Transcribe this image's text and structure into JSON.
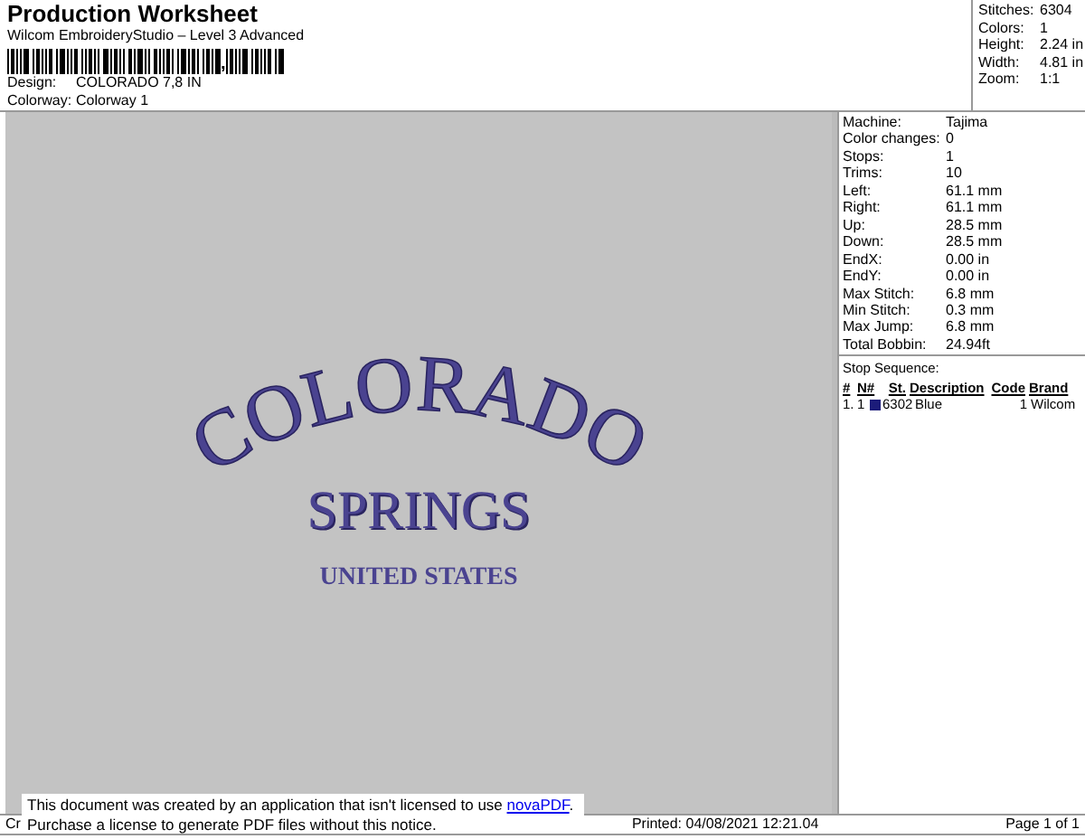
{
  "header": {
    "title": "Production Worksheet",
    "subtitle": "Wilcom EmbroideryStudio – Level 3 Advanced",
    "barcode_text": ",",
    "fields": [
      {
        "label": "Design:",
        "value": "COLORADO 7,8 IN"
      },
      {
        "label": "Colorway:",
        "value": "Colorway 1"
      }
    ]
  },
  "summary": [
    {
      "label": "Stitches:",
      "value": "6304"
    },
    {
      "label": "Colors:",
      "value": "1"
    },
    {
      "label": "Height:",
      "value": "2.24 in"
    },
    {
      "label": "Width:",
      "value": "4.81 in"
    },
    {
      "label": "Zoom:",
      "value": "1:1"
    }
  ],
  "design": {
    "lines": [
      {
        "kind": "arc",
        "text": "COLORADO"
      },
      {
        "kind": "large",
        "text": "SPRINGS"
      },
      {
        "kind": "small",
        "text": "UNITED STATES"
      }
    ]
  },
  "details": [
    {
      "label": "Machine:",
      "value": "Tajima"
    },
    {
      "label": "Color changes:",
      "value": "0"
    },
    {
      "label": "Stops:",
      "value": "1"
    },
    {
      "label": "Trims:",
      "value": "10"
    },
    {
      "label": "Left:",
      "value": "61.1 mm"
    },
    {
      "label": "Right:",
      "value": "61.1 mm"
    },
    {
      "label": "Up:",
      "value": "28.5 mm"
    },
    {
      "label": "Down:",
      "value": "28.5 mm"
    },
    {
      "label": "EndX:",
      "value": "0.00 in"
    },
    {
      "label": "EndY:",
      "value": "0.00 in"
    },
    {
      "label": "Max Stitch:",
      "value": "6.8 mm"
    },
    {
      "label": "Min Stitch:",
      "value": "0.3 mm"
    },
    {
      "label": "Max Jump:",
      "value": "6.8 mm"
    },
    {
      "label": "Total Bobbin:",
      "value": "24.94ft"
    }
  ],
  "stop_sequence": {
    "title": "Stop Sequence:",
    "columns": [
      "#",
      "N#",
      "St.",
      "Description",
      "Code",
      "Brand"
    ],
    "rows": [
      {
        "index": "1.",
        "n": "1",
        "color": "#1c1c7a",
        "stitches": "6302",
        "description": "Blue",
        "code": "1",
        "brand": "Wilcom"
      }
    ]
  },
  "footer": {
    "left": "Cr",
    "printed": "Printed: 04/08/2021 12:21.04",
    "page": "Page 1 of 1"
  },
  "notice": {
    "line_1": "This document was created by an application that isn't licensed to use ",
    "link": "novaPDF",
    "line_1_end": ".",
    "line_2": "Purchase a license to generate PDF files without this notice."
  }
}
